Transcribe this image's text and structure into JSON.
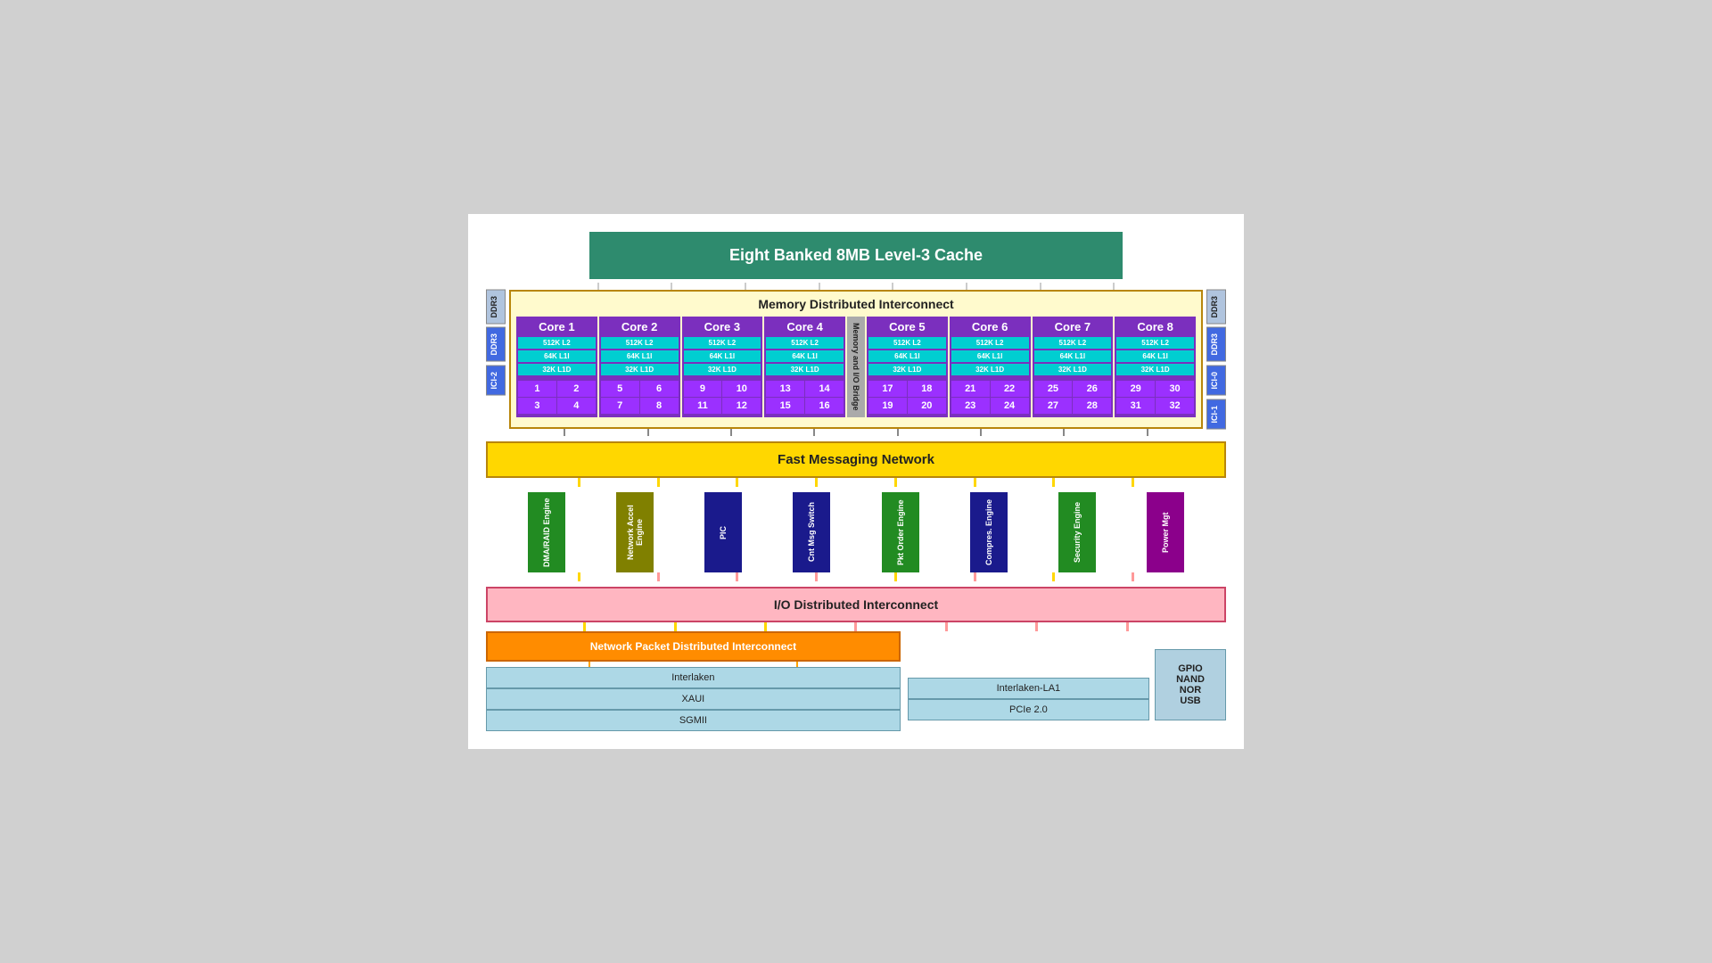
{
  "l3cache": {
    "label": "Eight Banked 8MB Level-3 Cache"
  },
  "mem_interconnect": {
    "label": "Memory Distributed Interconnect"
  },
  "ddr3_left": [
    "DDR3",
    "DDR3"
  ],
  "ddr3_right": [
    "DDR3",
    "ICI-0",
    "ICI-1"
  ],
  "ici_left": [
    "ICI-2"
  ],
  "cores": [
    {
      "title": "Core 1",
      "caches": [
        "512K L2",
        "64K L1I",
        "32K L1D"
      ],
      "threads": [
        "1",
        "2",
        "3",
        "4"
      ]
    },
    {
      "title": "Core 2",
      "caches": [
        "512K L2",
        "64K L1I",
        "32K L1D"
      ],
      "threads": [
        "5",
        "6",
        "7",
        "8"
      ]
    },
    {
      "title": "Core 3",
      "caches": [
        "512K L2",
        "64K L1I",
        "32K L1D"
      ],
      "threads": [
        "9",
        "10",
        "11",
        "12"
      ]
    },
    {
      "title": "Core 4",
      "caches": [
        "512K L2",
        "64K L1I",
        "32K L1D"
      ],
      "threads": [
        "13",
        "14",
        "15",
        "16"
      ]
    },
    {
      "title": "Core 5",
      "caches": [
        "512K L2",
        "64K L1I",
        "32K L1D"
      ],
      "threads": [
        "17",
        "18",
        "19",
        "20"
      ]
    },
    {
      "title": "Core 6",
      "caches": [
        "512K L2",
        "64K L1I",
        "32K L1D"
      ],
      "threads": [
        "21",
        "22",
        "23",
        "24"
      ]
    },
    {
      "title": "Core 7",
      "caches": [
        "512K L2",
        "64K L1I",
        "32K L1D"
      ],
      "threads": [
        "25",
        "26",
        "27",
        "28"
      ]
    },
    {
      "title": "Core 8",
      "caches": [
        "512K L2",
        "64K L1I",
        "32K L1D"
      ],
      "threads": [
        "29",
        "30",
        "31",
        "32"
      ]
    }
  ],
  "bridge_label": "Memory and I/O Bridge",
  "fast_msg": {
    "label": "Fast Messaging Network"
  },
  "engines": [
    {
      "label": "DMA/RAID Engine",
      "color": "green"
    },
    {
      "label": "Network Accel Engine",
      "color": "olive"
    },
    {
      "label": "PIC",
      "color": "darkblue"
    },
    {
      "label": "Cnt Msg Switch",
      "color": "darkblue"
    },
    {
      "label": "Pkt Order Engine",
      "color": "green"
    },
    {
      "label": "Compres. Engine",
      "color": "darkblue"
    },
    {
      "label": "Security Engine",
      "color": "green"
    },
    {
      "label": "Power Mgt",
      "color": "purple"
    }
  ],
  "io_interconnect": {
    "label": "I/O Distributed Interconnect"
  },
  "network_packet": {
    "label": "Network Packet Distributed Interconnect"
  },
  "left_net_rows": [
    "Interlaken",
    "XAUI",
    "SGMII"
  ],
  "right_net_rows": [
    "Interlaken-LA1",
    "PCIe 2.0"
  ],
  "gpio": {
    "label": "GPIO\nNAND\nNOR\nUSB"
  }
}
